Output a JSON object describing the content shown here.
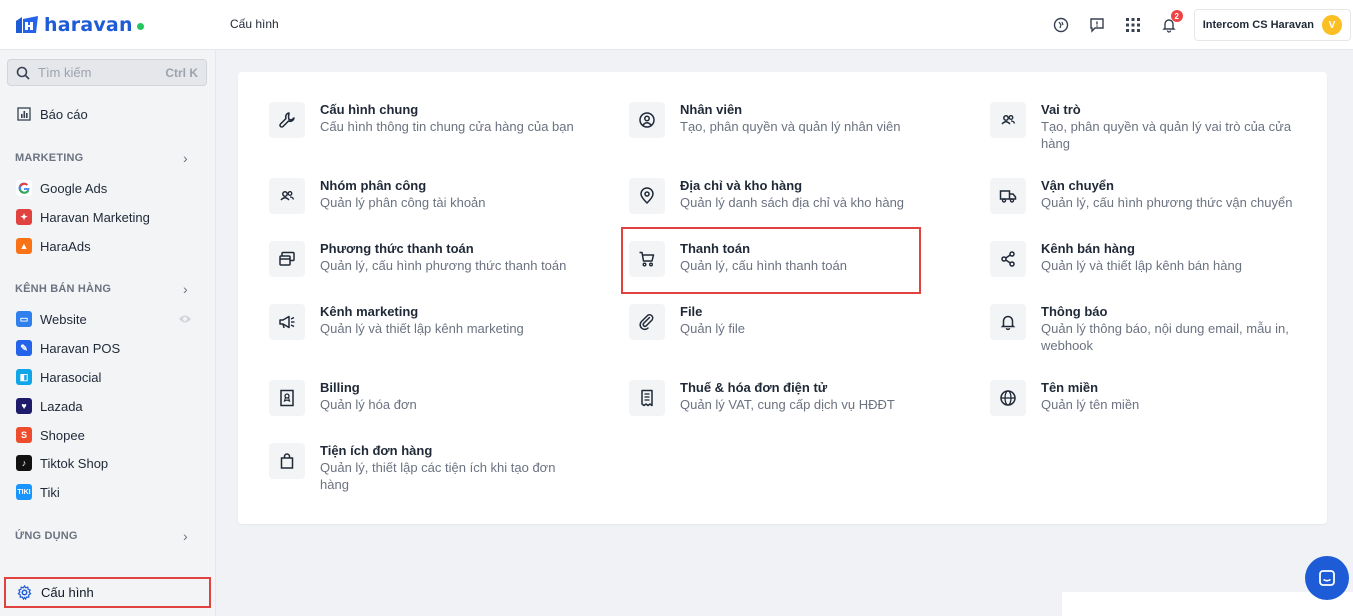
{
  "app": {
    "logo_text": "haravan",
    "breadcrumb": "Cấu hình",
    "account_name": "Intercom CS Haravan",
    "avatar_letter": "V",
    "notification_count": "2"
  },
  "sidebar": {
    "search_placeholder": "Tìm kiếm",
    "search_shortcut": "Ctrl K",
    "report": "Báo cáo",
    "marketing_section": "MARKETING",
    "marketing_items": [
      "Google Ads",
      "Haravan Marketing",
      "HaraAds"
    ],
    "sales_section": "KÊNH BÁN HÀNG",
    "sales_items": [
      "Website",
      "Haravan POS",
      "Harasocial",
      "Lazada",
      "Shopee",
      "Tiktok Shop",
      "Tiki"
    ],
    "apps_section": "ỨNG DỤNG",
    "config": "Cấu hình"
  },
  "settings": [
    {
      "title": "Cấu hình chung",
      "desc": "Cấu hình thông tin chung cửa hàng của bạn",
      "icon": "wrench-icon"
    },
    {
      "title": "Nhân viên",
      "desc": "Tạo, phân quyền và quản lý nhân viên",
      "icon": "user-circle-icon"
    },
    {
      "title": "Vai trò",
      "desc": "Tạo, phân quyền và quản lý vai trò của cửa hàng",
      "icon": "users-icon"
    },
    {
      "title": "Nhóm phân công",
      "desc": "Quản lý phân công tài khoản",
      "icon": "group-icon"
    },
    {
      "title": "Địa chỉ và kho hàng",
      "desc": "Quản lý danh sách địa chỉ và kho hàng",
      "icon": "location-pin-icon"
    },
    {
      "title": "Vận chuyển",
      "desc": "Quản lý, cấu hình phương thức vận chuyển",
      "icon": "truck-icon"
    },
    {
      "title": "Phương thức thanh toán",
      "desc": "Quản lý, cấu hình phương thức thanh toán",
      "icon": "credit-cards-icon"
    },
    {
      "title": "Thanh toán",
      "desc": "Quản lý, cấu hình thanh toán",
      "icon": "cart-icon"
    },
    {
      "title": "Kênh bán hàng",
      "desc": "Quản lý và thiết lập kênh bán hàng",
      "icon": "share-icon"
    },
    {
      "title": "Kênh marketing",
      "desc": "Quản lý và thiết lập kênh marketing",
      "icon": "megaphone-icon"
    },
    {
      "title": "File",
      "desc": "Quản lý file",
      "icon": "paperclip-icon"
    },
    {
      "title": "Thông báo",
      "desc": "Quản lý thông báo, nội dung email, mẫu in, webhook",
      "icon": "bell-icon"
    },
    {
      "title": "Billing",
      "desc": "Quản lý hóa đơn",
      "icon": "receipt-icon"
    },
    {
      "title": "Thuế & hóa đơn điện tử",
      "desc": "Quản lý VAT, cung cấp dịch vụ HĐĐT",
      "icon": "invoice-icon"
    },
    {
      "title": "Tên miền",
      "desc": "Quản lý tên miền",
      "icon": "globe-icon"
    },
    {
      "title": "Tiện ích đơn hàng",
      "desc": "Quản lý, thiết lập các tiện ích khi tạo đơn hàng",
      "icon": "shopping-bag-icon"
    }
  ]
}
